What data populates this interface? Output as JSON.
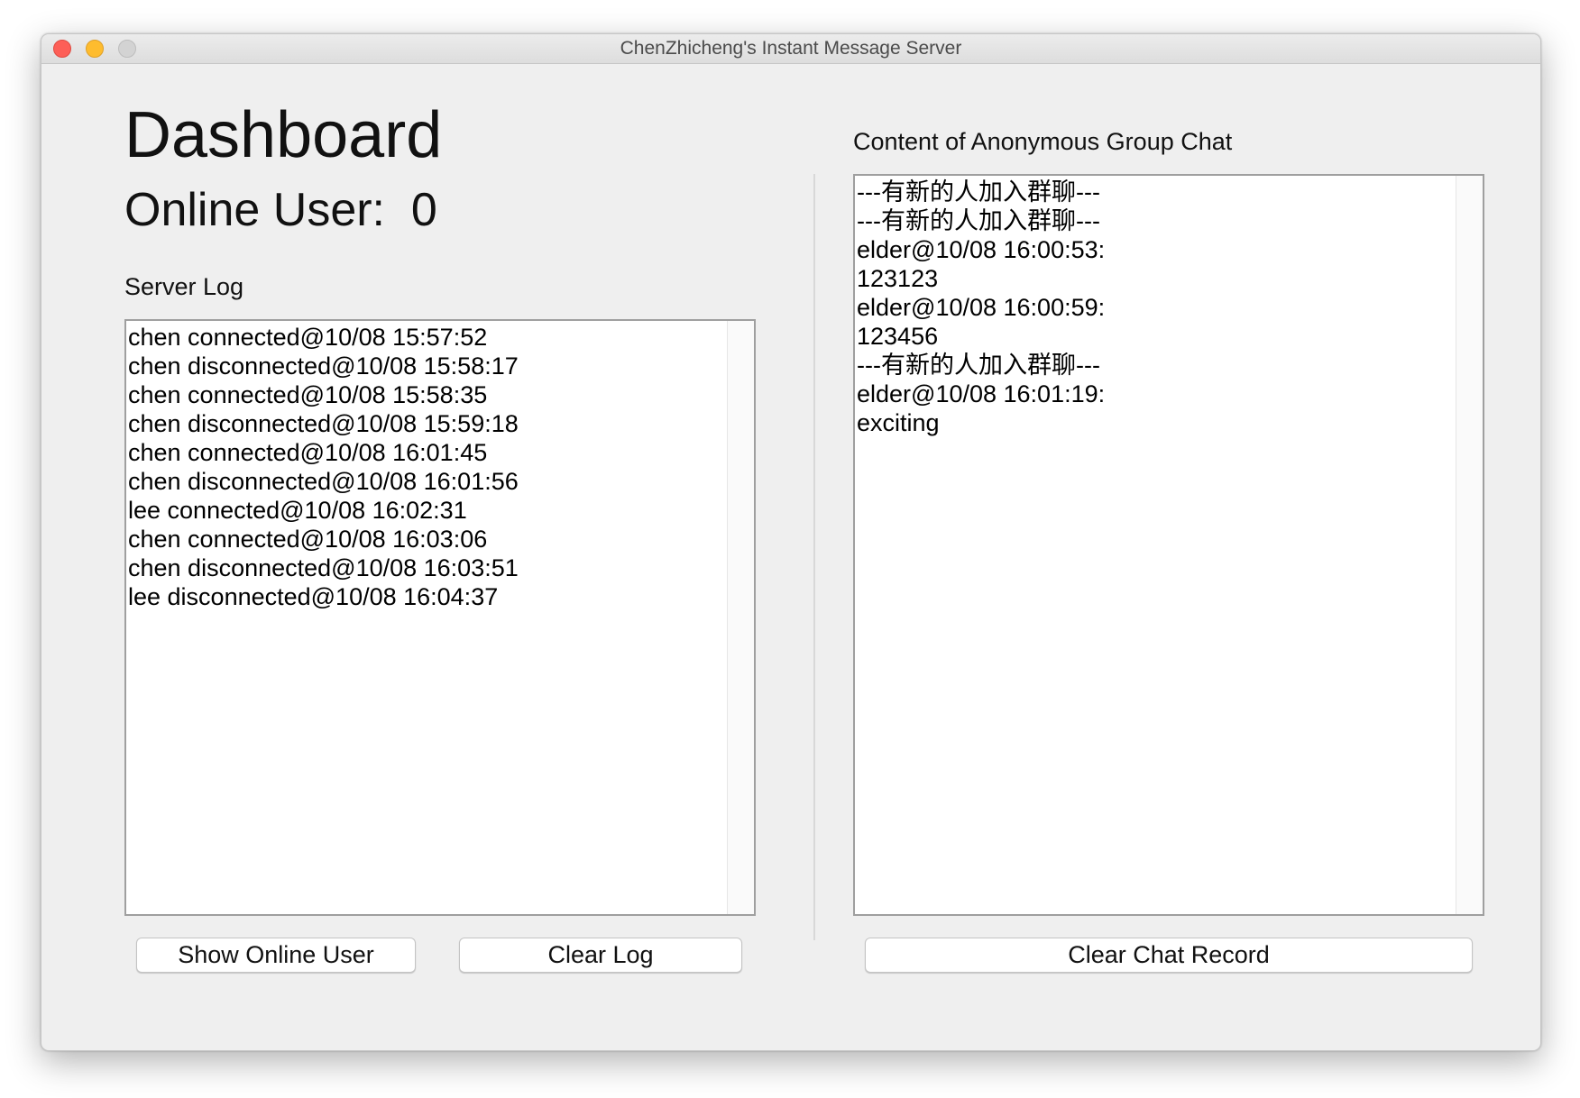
{
  "window": {
    "title": "ChenZhicheng's Instant Message Server"
  },
  "dashboard": {
    "heading": "Dashboard",
    "online_user_label": "Online User:",
    "online_user_count": "0"
  },
  "server_log": {
    "label": "Server Log",
    "lines": [
      "chen connected@10/08 15:57:52",
      "chen disconnected@10/08 15:58:17",
      "chen connected@10/08 15:58:35",
      "chen disconnected@10/08 15:59:18",
      "chen connected@10/08 16:01:45",
      "chen disconnected@10/08 16:01:56",
      "lee connected@10/08 16:02:31",
      "chen connected@10/08 16:03:06",
      "chen disconnected@10/08 16:03:51",
      "lee disconnected@10/08 16:04:37"
    ]
  },
  "group_chat": {
    "label": "Content of Anonymous Group Chat",
    "lines": [
      "---有新的人加入群聊---",
      "---有新的人加入群聊---",
      "elder@10/08 16:00:53:",
      "123123",
      "elder@10/08 16:00:59:",
      "123456",
      "---有新的人加入群聊---",
      "elder@10/08 16:01:19:",
      "exciting"
    ]
  },
  "buttons": {
    "show_online_user": "Show Online User",
    "clear_log": "Clear Log",
    "clear_chat_record": "Clear Chat Record"
  },
  "colors": {
    "window_bg": "#efefef",
    "close": "#fd5f57",
    "minimize": "#febc2e",
    "maximize_disabled": "#d3d3d3"
  }
}
